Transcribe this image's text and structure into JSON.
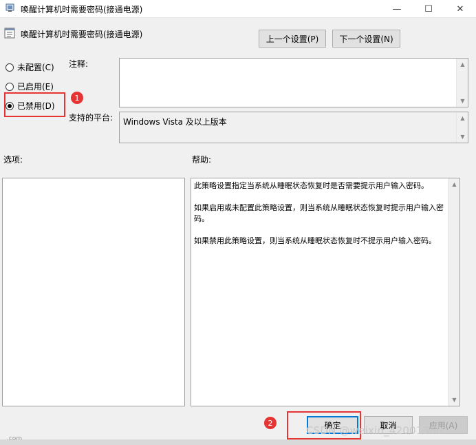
{
  "window": {
    "title": "唤醒计算机时需要密码(接通电源)",
    "minimize": "—",
    "maximize": "☐",
    "close": "✕"
  },
  "header": {
    "title": "唤醒计算机时需要密码(接通电源)",
    "prev_button": "上一个设置(P)",
    "next_button": "下一个设置(N)"
  },
  "options": {
    "not_configured": "未配置(C)",
    "enabled": "已启用(E)",
    "disabled": "已禁用(D)",
    "selected": "disabled"
  },
  "comment": {
    "label": "注释:",
    "value": ""
  },
  "platform": {
    "label": "支持的平台:",
    "value": "Windows Vista 及以上版本"
  },
  "sections": {
    "options_label": "选项:",
    "help_label": "帮助:"
  },
  "help": {
    "p1": "此策略设置指定当系统从睡眠状态恢复时是否需要提示用户输入密码。",
    "p2": "如果启用或未配置此策略设置，则当系统从睡眠状态恢复时提示用户输入密码。",
    "p3": "如果禁用此策略设置，则当系统从睡眠状态恢复时不提示用户输入密码。"
  },
  "footer": {
    "ok": "确定",
    "cancel": "取消",
    "apply": "应用(A)"
  },
  "annotations": {
    "badge1": "1",
    "badge2": "2",
    "color": "#e63434"
  },
  "watermark": "CSDN @weixin_42001360",
  "bottom_fragment": ".com"
}
